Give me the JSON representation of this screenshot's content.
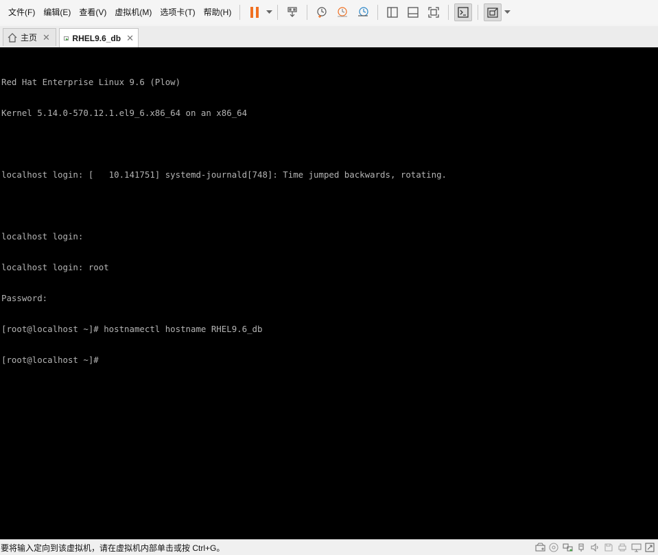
{
  "menubar": {
    "items": [
      {
        "label": "文件(F)"
      },
      {
        "label": "编辑(E)"
      },
      {
        "label": "查看(V)"
      },
      {
        "label": "虚拟机(M)"
      },
      {
        "label": "选项卡(T)"
      },
      {
        "label": "帮助(H)"
      }
    ]
  },
  "toolbar": {
    "icons": [
      "pause-icon",
      "send-ctrl-alt-del-icon",
      "snapshot-take-icon",
      "snapshot-revert-icon",
      "snapshot-manager-icon",
      "library-view-icon",
      "thumbnail-bar-icon",
      "fullscreen-icon",
      "console-view-icon",
      "fit-window-icon"
    ],
    "accent": "#f07021"
  },
  "tabs": [
    {
      "label": "主页",
      "active": false
    },
    {
      "label": "RHEL9.6_db",
      "active": true
    }
  ],
  "console": {
    "background": "#000000",
    "foreground": "#b4b4b4",
    "lines": [
      "Red Hat Enterprise Linux 9.6 (Plow)",
      "Kernel 5.14.0-570.12.1.el9_6.x86_64 on an x86_64",
      "",
      "localhost login: [   10.141751] systemd-journald[748]: Time jumped backwards, rotating.",
      "",
      "localhost login:",
      "localhost login: root",
      "Password:",
      "[root@localhost ~]# hostnamectl hostname RHEL9.6_db",
      "[root@localhost ~]#"
    ]
  },
  "statusbar": {
    "text": "要将输入定向到该虚拟机，请在虚拟机内部单击或按 Ctrl+G。",
    "icons": [
      "hard-disk-icon",
      "cd-dvd-icon",
      "network-adapter-icon",
      "usb-icon",
      "sound-icon",
      "floppy-icon",
      "printer-icon",
      "display-icon",
      "stretch-icon"
    ]
  }
}
